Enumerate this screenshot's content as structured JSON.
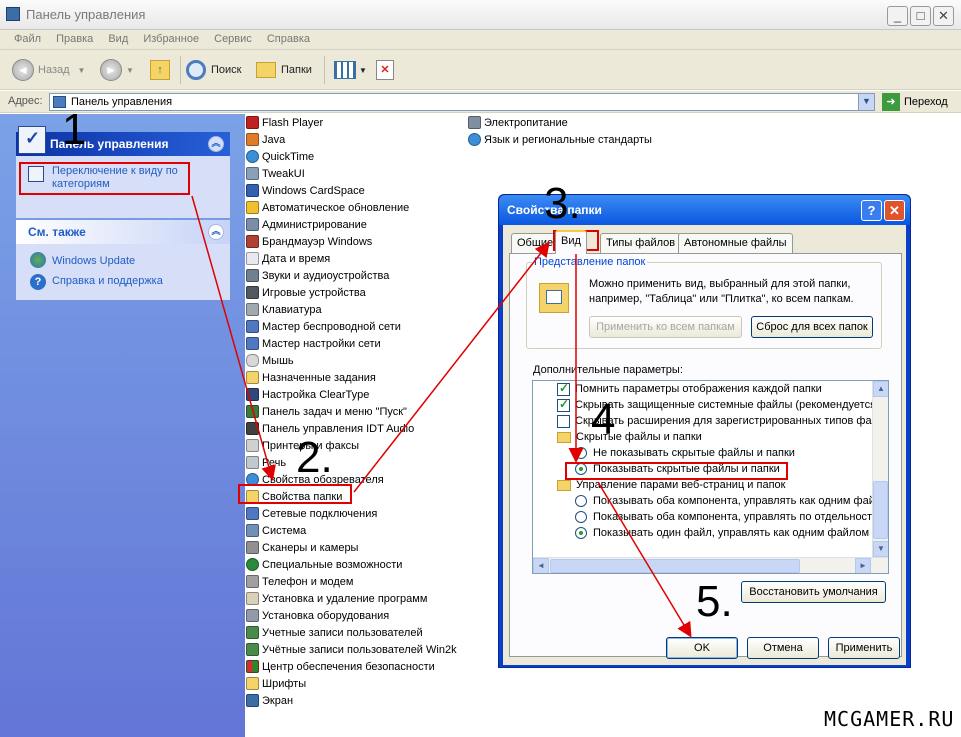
{
  "window": {
    "title": "Панель управления"
  },
  "menu": [
    "Файл",
    "Правка",
    "Вид",
    "Избранное",
    "Сервис",
    "Справка"
  ],
  "toolbar": {
    "back": "Назад",
    "search": "Поиск",
    "folders": "Папки"
  },
  "address": {
    "label": "Адрес:",
    "value": "Панель управления",
    "go": "Переход"
  },
  "left_pane": {
    "main_panel": {
      "title": "Панель управления",
      "switch_link": "Переключение к виду по категориям"
    },
    "see_also": {
      "title": "См. также",
      "links": [
        "Windows Update",
        "Справка и поддержка"
      ]
    }
  },
  "items_col1": [
    "Flash Player",
    "Java",
    "QuickTime",
    "TweakUI",
    "Windows CardSpace",
    "Автоматическое обновление",
    "Администрирование",
    "Брандмауэр Windows",
    "Дата и время",
    "Звуки и аудиоустройства",
    "Игровые устройства",
    "Клавиатура",
    "Мастер беспроводной сети",
    "Мастер настройки сети",
    "Мышь",
    "Назначенные задания",
    "Настройка ClearType",
    "Панель задач и меню \"Пуск\"",
    "Панель управления IDT Audio",
    "Принтеры и факсы",
    "Речь",
    "Свойства обозревателя",
    "Свойства папки",
    "Сетевые подключения",
    "Система",
    "Сканеры и камеры",
    "Специальные возможности",
    "Телефон и модем",
    "Установка и удаление программ",
    "Установка оборудования",
    "Учетные записи пользователей",
    "Учётные записи пользователей Win2k",
    "Центр обеспечения безопасности",
    "Шрифты",
    "Экран"
  ],
  "items_col2": [
    "Электропитание",
    "Язык и региональные стандарты"
  ],
  "dialog": {
    "title": "Свойства папки",
    "tabs": [
      "Общие",
      "Вид",
      "Типы файлов",
      "Автономные файлы"
    ],
    "folder_view": {
      "label": "Представление папок",
      "description": "Можно применить вид, выбранный для этой папки, например, \"Таблица\" или \"Плитка\", ко всем папкам.",
      "apply_all": "Применить ко всем папкам",
      "reset_all": "Сброс для всех папок"
    },
    "advanced_label": "Дополнительные параметры:",
    "settings": [
      {
        "type": "check",
        "checked": true,
        "text": "Помнить параметры отображения каждой папки"
      },
      {
        "type": "check",
        "checked": true,
        "text": "Скрывать защищенные системные файлы (рекомендуется)"
      },
      {
        "type": "check",
        "checked": false,
        "text": "Скрывать расширения для зарегистрированных типов файлов"
      },
      {
        "type": "folder",
        "text": "Скрытые файлы и папки"
      },
      {
        "type": "radio",
        "checked": false,
        "text": "Не показывать скрытые файлы и папки"
      },
      {
        "type": "radio",
        "checked": true,
        "text": "Показывать скрытые файлы и папки"
      },
      {
        "type": "folder",
        "text": "Управление парами веб-страниц и папок"
      },
      {
        "type": "radio",
        "checked": false,
        "text": "Показывать оба компонента, управлять как одним файлом"
      },
      {
        "type": "radio",
        "checked": false,
        "text": "Показывать оба компонента, управлять по отдельности"
      },
      {
        "type": "radio",
        "checked": true,
        "text": "Показывать один файл, управлять как одним файлом"
      }
    ],
    "restore_defaults": "Восстановить умолчания",
    "ok": "OK",
    "cancel": "Отмена",
    "apply": "Применить"
  },
  "annotations": [
    "1",
    "2.",
    "3.",
    "4",
    "5."
  ],
  "watermark": "MCGAMER.RU",
  "colors": {
    "xp_blue": "#0a56e0",
    "panel_blue": "#6375d6",
    "annotation_red": "#e00000"
  }
}
